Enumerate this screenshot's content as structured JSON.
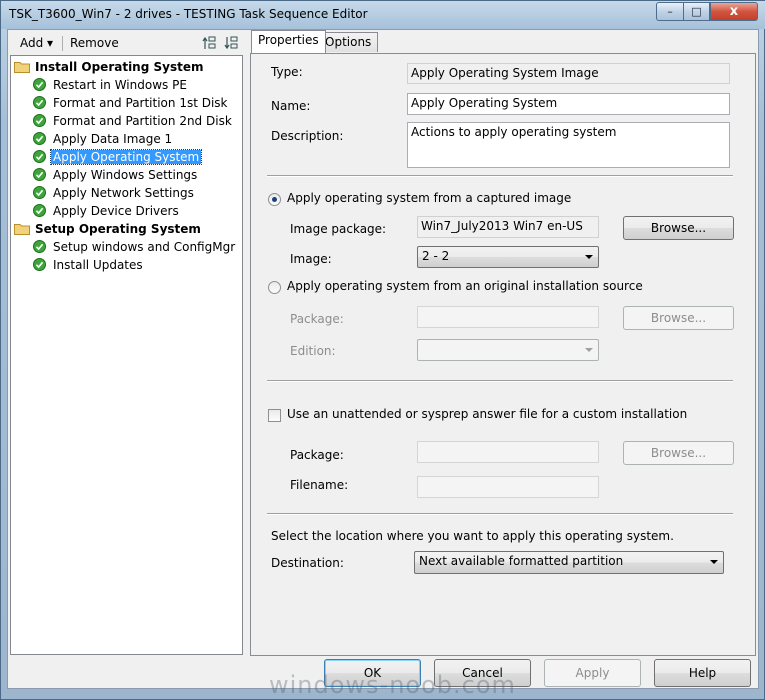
{
  "window": {
    "title": "TSK_T3600_Win7 - 2 drives - TESTING Task Sequence Editor",
    "controls": {
      "minimize": "–",
      "maximize": "□",
      "close": "x"
    }
  },
  "toolbar": {
    "add_label": "Add ▾",
    "remove_label": "Remove"
  },
  "tree": {
    "groups": [
      {
        "label": "Install Operating System",
        "items": [
          "Restart in Windows PE",
          "Format and Partition 1st Disk",
          "Format and Partition 2nd Disk",
          "Apply Data Image 1",
          "Apply Operating System",
          "Apply Windows Settings",
          "Apply Network Settings",
          "Apply Device Drivers"
        ]
      },
      {
        "label": "Setup Operating System",
        "items": [
          "Setup windows and ConfigMgr",
          "Install Updates"
        ]
      }
    ],
    "selected": "Apply Operating System"
  },
  "tabs": {
    "properties": "Properties",
    "options": "Options"
  },
  "props": {
    "type_label": "Type:",
    "type_value": "Apply Operating System Image",
    "name_label": "Name:",
    "name_value": "Apply Operating System",
    "description_label": "Description:",
    "description_value": "Actions to apply operating system"
  },
  "captured": {
    "radio_label": "Apply operating system from a captured image",
    "image_package_label": "Image package:",
    "image_package_value": "Win7_July2013 Win7 en-US",
    "browse_label": "Browse...",
    "image_label": "Image:",
    "image_value": "2 - 2"
  },
  "original": {
    "radio_label": "Apply operating system from an original installation source",
    "package_label": "Package:",
    "browse_label": "Browse...",
    "edition_label": "Edition:"
  },
  "unattend": {
    "check_label": "Use an unattended or sysprep answer file for a custom installation",
    "package_label": "Package:",
    "browse_label": "Browse...",
    "filename_label": "Filename:"
  },
  "destination": {
    "intro": "Select the location where you want to apply this operating system.",
    "label": "Destination:",
    "value": "Next available formatted partition"
  },
  "buttons": {
    "ok": "OK",
    "cancel": "Cancel",
    "apply": "Apply",
    "help": "Help"
  },
  "watermark": "windows-noob.com",
  "colors": {
    "selection": "#3399ff",
    "check_green": "#3da63a",
    "folder": "#e8c35a"
  }
}
